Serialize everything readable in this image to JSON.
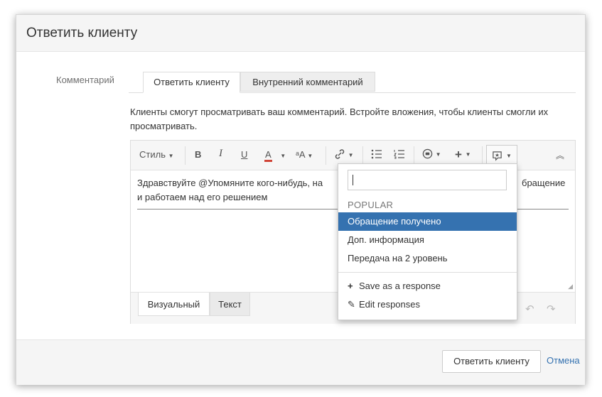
{
  "dialog": {
    "title": "Ответить клиенту",
    "field_label": "Комментарий",
    "tabs": [
      {
        "label": "Ответить клиенту"
      },
      {
        "label": "Внутренний комментарий"
      }
    ],
    "help_text": "Клиенты смогут просматривать ваш комментарий. Встройте вложения, чтобы клиенты смогли их просматривать."
  },
  "toolbar": {
    "style_label": "Стиль",
    "bold": "B",
    "italic": "I",
    "underline": "U",
    "text_color": "A",
    "font_size": "ᵃA",
    "link_icon": "link-icon",
    "bullet_list_icon": "bullet-list-icon",
    "numbered_list_icon": "numbered-list-icon",
    "emoji_icon": "emoji-icon",
    "insert_icon": "plus-icon",
    "canned_response_icon": "canned-response-icon",
    "collapse_icon": "collapse-icon"
  },
  "editor": {
    "content_left": "Здравствуйте  @Упомяните кого-нибудь, на",
    "content_right": "бращение",
    "content_line2": "и работаем над его решением",
    "mode_tabs": [
      {
        "label": "Визуальный"
      },
      {
        "label": "Текст"
      }
    ]
  },
  "dropdown": {
    "search_value": "",
    "section_label": "POPULAR",
    "items": [
      {
        "label": "Обращение получено",
        "highlighted": true
      },
      {
        "label": "Доп. информация"
      },
      {
        "label": "Передача на 2 уровень"
      }
    ],
    "actions": [
      {
        "label": "Save as a response",
        "icon": "plus-icon"
      },
      {
        "label": "Edit responses",
        "icon": "pencil-icon"
      }
    ]
  },
  "footer": {
    "submit_label": "Ответить клиенту",
    "cancel_label": "Отмена"
  },
  "colors": {
    "accent": "#3572b0",
    "text_color_underline": "#d04437"
  }
}
